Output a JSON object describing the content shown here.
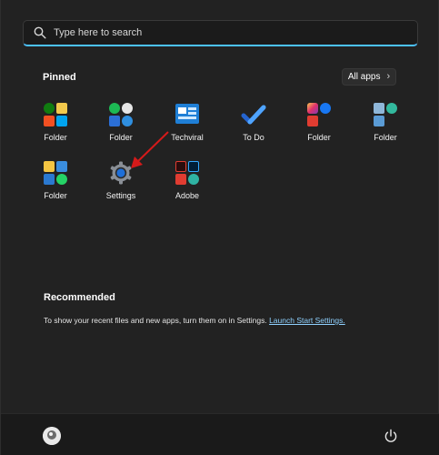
{
  "search": {
    "placeholder": "Type here to search"
  },
  "pinned": {
    "title": "Pinned",
    "all_apps_label": "All apps",
    "apps": [
      {
        "label": "Folder",
        "icon": "folder-xbox-store-icon"
      },
      {
        "label": "Folder",
        "icon": "folder-spotify-clock-icon"
      },
      {
        "label": "Techviral",
        "icon": "techviral-icon"
      },
      {
        "label": "To Do",
        "icon": "todo-check-icon"
      },
      {
        "label": "Folder",
        "icon": "folder-instagram-facebook-icon"
      },
      {
        "label": "Folder",
        "icon": "folder-notepad-edge-icon"
      },
      {
        "label": "Folder",
        "icon": "folder-explorer-whatsapp-icon"
      },
      {
        "label": "Settings",
        "icon": "settings-gear-icon"
      },
      {
        "label": "Adobe",
        "icon": "adobe-folder-icon"
      }
    ]
  },
  "recommended": {
    "title": "Recommended",
    "message": "To show your recent files and new apps, turn them on in Settings.",
    "link": "Launch Start Settings."
  },
  "taskbar": {
    "user_icon": "user-avatar-icon",
    "power_icon": "power-icon"
  },
  "colors": {
    "accent": "#4cc2ff",
    "background": "#222222",
    "link": "#8fd1ff",
    "annotation_arrow": "#d51a1a"
  }
}
